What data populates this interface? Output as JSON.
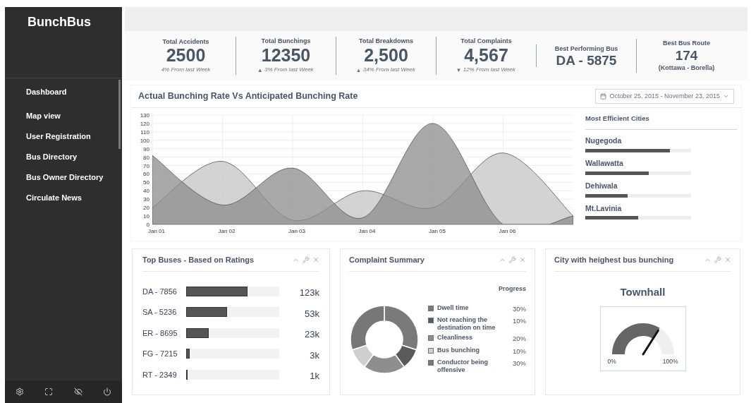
{
  "sidebar": {
    "brand": "BunchBus",
    "items": [
      {
        "label": "Dashboard"
      },
      {
        "label": "Map view"
      },
      {
        "label": "User Registration"
      },
      {
        "label": "Bus Directory"
      },
      {
        "label": "Bus Owner Directory"
      },
      {
        "label": "Circulate News"
      }
    ]
  },
  "stats": [
    {
      "kind": "stat",
      "label": "Total Accidents",
      "value": "2500",
      "change": "4% From last Week"
    },
    {
      "kind": "stat",
      "label": "Total Bunchings",
      "value": "12350",
      "arrow": "▴",
      "change": "3% From last Week"
    },
    {
      "kind": "stat",
      "label": "Total Breakdowns",
      "value": "2,500",
      "arrow": "▴",
      "change": "34% From last Week"
    },
    {
      "kind": "stat",
      "label": "Total Complaints",
      "value": "4,567",
      "arrow": "▾",
      "change": "12% From last Week"
    },
    {
      "kind": "best",
      "label": "Best Performing Bus",
      "value": "DA - 5875"
    },
    {
      "kind": "best",
      "label": "Best Bus Route",
      "value": "174",
      "note": "(Kottawa - Borella)"
    }
  ],
  "rate_panel": {
    "title": "Actual Bunching Rate Vs Anticipated Bunching Rate",
    "date_range": "October 25, 2015 - November 23, 2015",
    "chart_data": {
      "type": "area",
      "grid": true,
      "categories": [
        "Jan 01",
        "Jan 02",
        "Jan 03",
        "Jan 04",
        "Jan 05",
        "Jan 06",
        null
      ],
      "ylim": [
        0,
        130
      ],
      "yticks": [
        0,
        10,
        20,
        30,
        40,
        50,
        60,
        70,
        80,
        90,
        100,
        110,
        120,
        130
      ],
      "series": [
        {
          "color": "#c4c4c4",
          "values": [
            20,
            75,
            5,
            40,
            20,
            85,
            10
          ]
        },
        {
          "color": "#8c8c8c",
          "values": [
            82,
            23,
            67,
            8,
            120,
            0,
            10
          ]
        }
      ]
    },
    "cities_title": "Most Efficient Cities",
    "cities": [
      {
        "name": "Nugegoda",
        "level": 0.8
      },
      {
        "name": "Wallawatta",
        "level": 0.6
      },
      {
        "name": "Dehiwala",
        "level": 0.4
      },
      {
        "name": "Mt.Lavinia",
        "level": 0.5
      }
    ]
  },
  "top_buses": {
    "title": "Top Buses  - Based on Ratings",
    "rows": [
      {
        "bus": "DA - 7856",
        "level": 0.66,
        "count": "123k"
      },
      {
        "bus": "SA - 5236",
        "level": 0.44,
        "count": "53k"
      },
      {
        "bus": "ER - 8695",
        "level": 0.24,
        "count": "23k"
      },
      {
        "bus": "FG - 7215",
        "level": 0.04,
        "count": "3k"
      },
      {
        "bus": "RT - 2349",
        "level": 0.01,
        "count": "1k"
      }
    ]
  },
  "complaints": {
    "title": "Complaint Summary",
    "progress_heading": "Progress",
    "chart_data": {
      "type": "donut",
      "categories": [
        "Dwell time",
        "Not reaching the destination on time",
        "Cleanliness",
        "Bus bunching",
        "Conductor being offensive"
      ],
      "values": [
        30,
        10,
        20,
        10,
        30
      ],
      "value_labels": [
        "30%",
        "10%",
        "20%",
        "10%",
        "30%"
      ],
      "colors": [
        "#7a7a7a",
        "#5a5a5a",
        "#8e8e8e",
        "#cfcfcf",
        "#777777"
      ]
    }
  },
  "city_panel": {
    "title": "City with heighest bus bunching",
    "city": "Townhall",
    "gauge": {
      "min_label": "0%",
      "max_label": "100%"
    }
  }
}
